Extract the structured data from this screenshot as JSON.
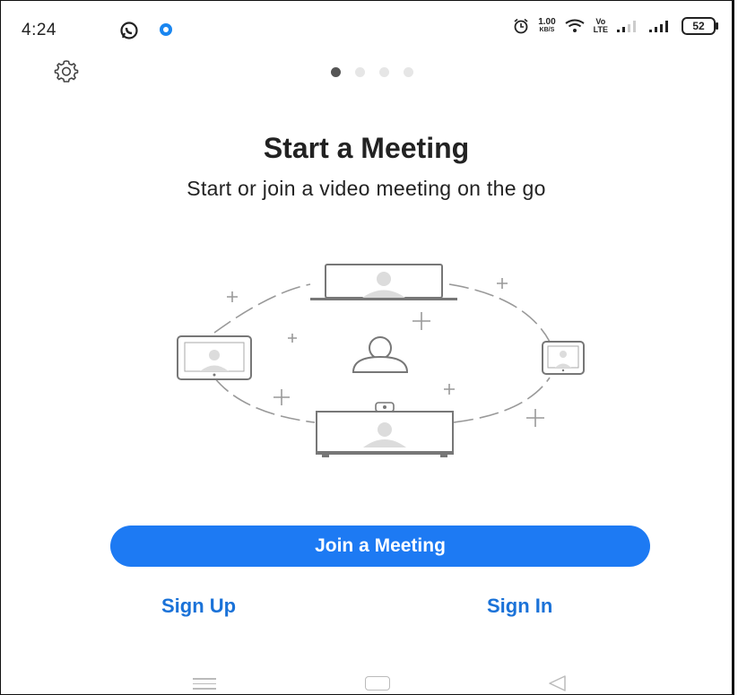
{
  "status_bar": {
    "time": "4:24",
    "speed_value": "1.00",
    "speed_unit": "KB/S",
    "network_top": "Vo",
    "network_bottom": "LTE",
    "battery": "52"
  },
  "onboarding": {
    "page_count": 4,
    "active_page": 1,
    "title": "Start a Meeting",
    "subtitle": "Start or join a video meeting on the go"
  },
  "actions": {
    "join_label": "Join a Meeting",
    "sign_up_label": "Sign Up",
    "sign_in_label": "Sign In"
  },
  "icons": {
    "settings": "gear-icon",
    "illustration": "devices-meeting-illustration"
  },
  "colors": {
    "accent": "#1d7af3",
    "link": "#1a72d8"
  }
}
